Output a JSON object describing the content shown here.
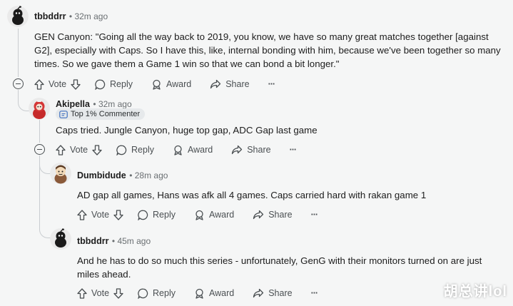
{
  "colors": {
    "background": "#f5f6f6",
    "text": "#1c1c1c",
    "muted": "#6a6f72",
    "thread_line": "#c9cdd0",
    "badge_bg": "#e6e9eb"
  },
  "actions": {
    "vote": "Vote",
    "reply": "Reply",
    "award": "Award",
    "share": "Share",
    "more": "···"
  },
  "comments": [
    {
      "author": "tbbddrr",
      "time": "32m ago",
      "avatar_icon": "snoo-avatar-icon",
      "text_lines": [
        "GEN Canyon: \"Going all the way back to 2019, you know, we have so many great matches together [against",
        "G2], especially with Caps. So I have this, like, internal bonding with him, because we've been together so many",
        "times. So we gave them a Game 1 win so that we can bond a bit longer.\""
      ]
    },
    {
      "author": "Akipella",
      "time": "32m ago",
      "badge": "Top 1% Commenter",
      "avatar_icon": "red-hood-avatar-icon",
      "text_lines": [
        "Caps tried. Jungle Canyon, huge top gap, ADC Gap last game"
      ]
    },
    {
      "author": "Dumbidude",
      "time": "28m ago",
      "avatar_icon": "brown-snoo-avatar-icon",
      "text_lines": [
        "AD gap all games, Hans was afk all 4 games. Caps carried hard with rakan game 1"
      ]
    },
    {
      "author": "tbbddrr",
      "time": "45m ago",
      "avatar_icon": "snoo-avatar-icon",
      "text_lines": [
        "And he has to do so much this series - unfortunately, GenG with their monitors turned on are just",
        "miles ahead."
      ]
    }
  ],
  "watermark": "胡总讲lol"
}
